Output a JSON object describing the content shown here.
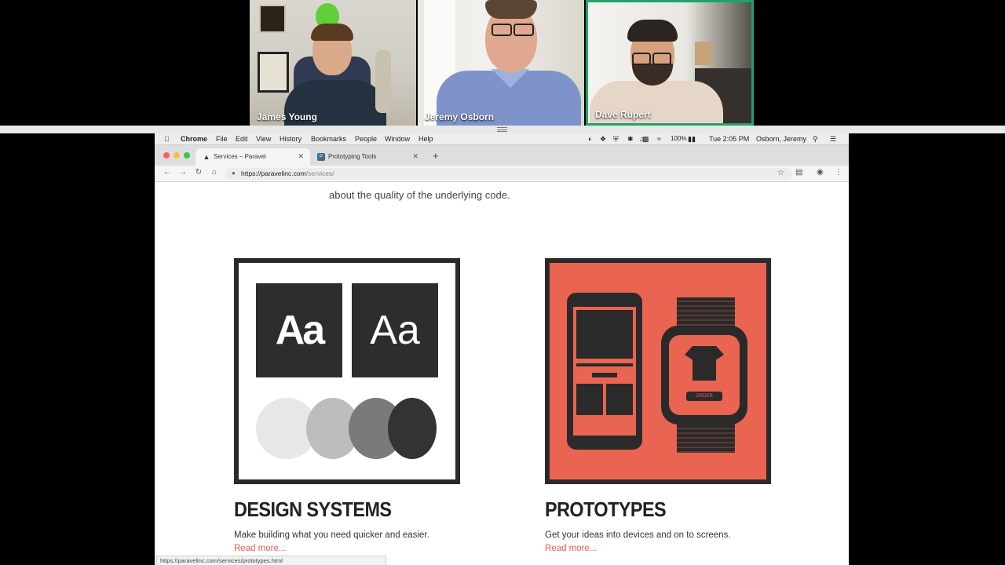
{
  "call": {
    "participants": [
      {
        "name": "James Young"
      },
      {
        "name": "Jeremy Osborn"
      },
      {
        "name": "Dave Rupert"
      }
    ],
    "active_speaker_color": "#1fa36a"
  },
  "menubar": {
    "app": "Chrome",
    "items": [
      "File",
      "Edit",
      "View",
      "History",
      "Bookmarks",
      "People",
      "Window",
      "Help"
    ],
    "battery": "100%",
    "clock": "Tue 2:05 PM",
    "user": "Osborn, Jeremy"
  },
  "browser": {
    "tabs": [
      {
        "title": "Services – Paravel",
        "active": true
      },
      {
        "title": "Prototyping Tools",
        "active": false
      }
    ],
    "url_host": "https://paravelinc.com",
    "url_path": "/services/",
    "status_url": "https://paravelinc.com/services/prototypes.html"
  },
  "page": {
    "intro_line": "about the quality of the underlying code.",
    "services": [
      {
        "title": "DESIGN SYSTEMS",
        "description": "Make building what you need quicker and easier.",
        "link": "Read more...",
        "art_text_bold": "Aa",
        "art_text_light": "Aa"
      },
      {
        "title": "PROTOTYPES",
        "description": "Get your ideas into devices and on to screens.",
        "link": "Read more...",
        "art_button": "ORDER",
        "accent": "#ea6452"
      }
    ]
  }
}
